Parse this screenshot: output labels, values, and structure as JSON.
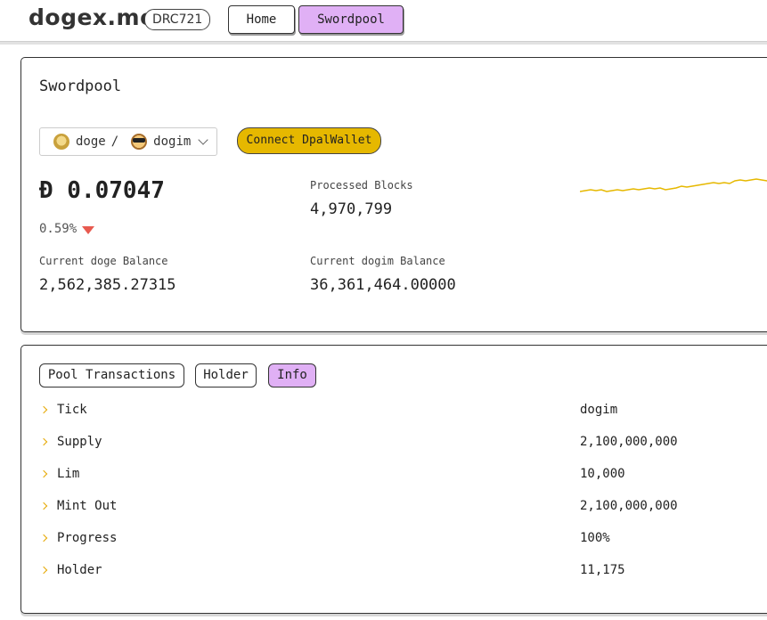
{
  "header": {
    "logo": "dogex.me",
    "badge": "DRC721",
    "nav": {
      "home": "Home",
      "swordpool": "Swordpool"
    }
  },
  "pool": {
    "title": "Swordpool",
    "pair": {
      "base": "doge",
      "separator": "/",
      "quote": "dogim"
    },
    "connect_label": "Connect DpalWallet",
    "price": "Đ 0.07047",
    "change": "0.59%",
    "processed_blocks_label": "Processed Blocks",
    "processed_blocks_value": "4,970,799",
    "doge_balance_label": "Current doge Balance",
    "doge_balance_value": "2,562,385.27315",
    "dogim_balance_label": "Current dogim Balance",
    "dogim_balance_value": "36,361,464.00000",
    "colors": {
      "accent": "#e6b800",
      "down": "#e85a4f",
      "active_tab": "#e0b0f5"
    }
  },
  "tabs": {
    "pool_transactions": "Pool Transactions",
    "holder": "Holder",
    "info": "Info"
  },
  "info": [
    {
      "key": "Tick",
      "value": "dogim"
    },
    {
      "key": "Supply",
      "value": "2,100,000,000"
    },
    {
      "key": "Lim",
      "value": "10,000"
    },
    {
      "key": "Mint Out",
      "value": "2,100,000,000"
    },
    {
      "key": "Progress",
      "value": "100%"
    },
    {
      "key": "Holder",
      "value": "11,175"
    }
  ]
}
